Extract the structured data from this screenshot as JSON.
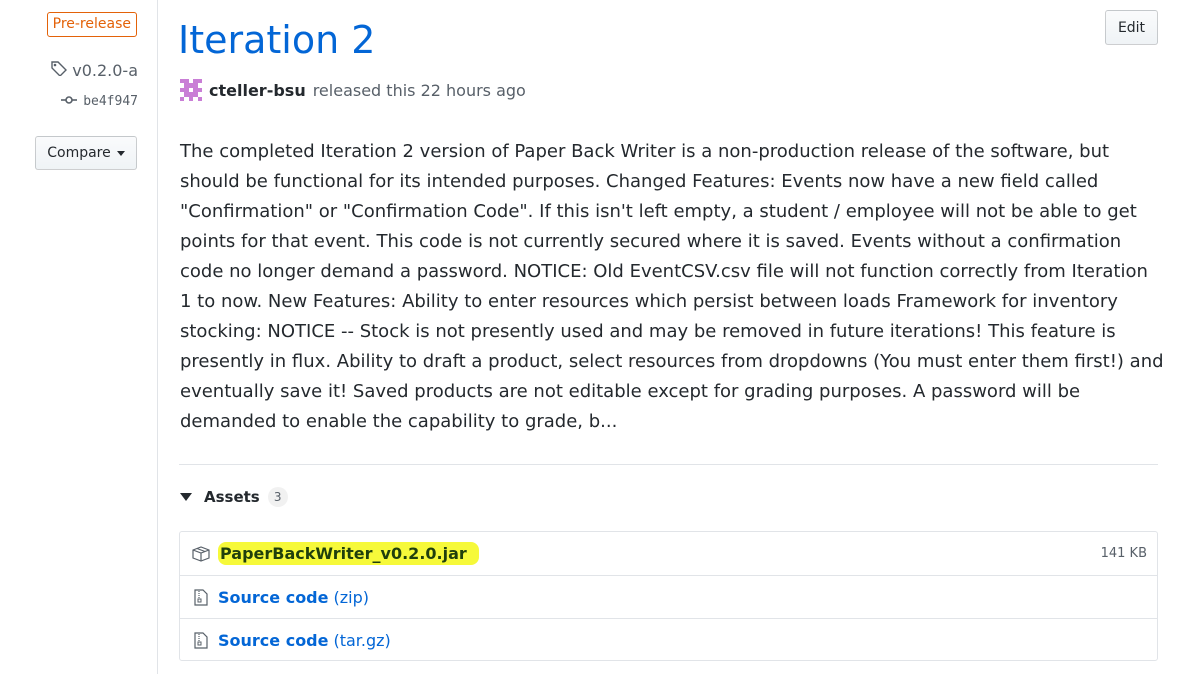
{
  "release": {
    "badge": "Pre-release",
    "tag": "v0.2.0-a",
    "commit": "be4f947",
    "compare_label": "Compare",
    "title": "Iteration 2",
    "edit_label": "Edit",
    "author": "cteller-bsu",
    "released_text": "released this 22 hours ago",
    "description": "The completed Iteration 2 version of Paper Back Writer is a non-production release of the software, but should be functional for its intended purposes. Changed Features: Events now have a new field called \"Confirmation\" or \"Confirmation Code\". If this isn't left empty, a student / employee will not be able to get points for that event. This code is not currently secured where it is saved. Events without a confirmation code no longer demand a password. NOTICE: Old EventCSV.csv file will not function correctly from Iteration 1 to now. New Features: Ability to enter resources which persist between loads Framework for inventory stocking: NOTICE -- Stock is not presently used and may be removed in future iterations! This feature is presently in flux. Ability to draft a product, select resources from dropdowns (You must enter them first!) and eventually save it! Saved products are not editable except for grading purposes. A password will be demanded to enable the capability to grade, b..."
  },
  "assets": {
    "heading": "Assets",
    "count": "3",
    "items": [
      {
        "name": "PaperBackWriter_v0.2.0.jar",
        "suffix": "",
        "size": "141 KB",
        "icon": "package-icon",
        "highlight": true
      },
      {
        "name": "Source code",
        "suffix": "(zip)",
        "size": "",
        "icon": "file-zip-icon",
        "highlight": false
      },
      {
        "name": "Source code",
        "suffix": "(tar.gz)",
        "size": "",
        "icon": "file-zip-icon",
        "highlight": false
      }
    ]
  },
  "colors": {
    "link": "#0366d6",
    "prerelease": "#e36209",
    "highlight": "#f6f93a",
    "avatar": "#c97ed6"
  }
}
